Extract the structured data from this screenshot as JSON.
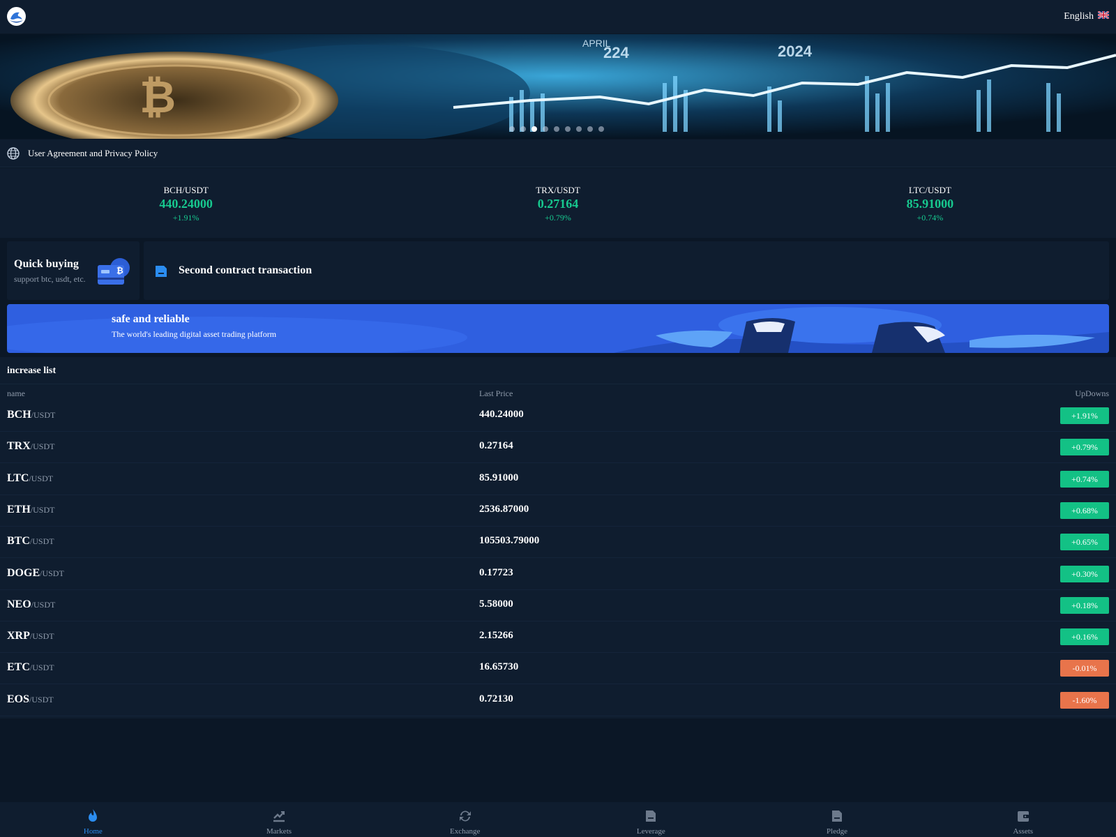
{
  "header": {
    "logo_icon": "dolphin-logo-icon",
    "language_label": "English",
    "flag_icon": "uk-flag-icon"
  },
  "banner": {
    "slide_count": 9,
    "active_slide": 3,
    "overlay_text": [
      "APRIL",
      "224",
      "2024"
    ]
  },
  "notice": {
    "icon": "globe-icon",
    "text": "User Agreement and Privacy Policy"
  },
  "tickers": [
    {
      "pair": "BCH/USDT",
      "price": "440.24000",
      "change": "+1.91%"
    },
    {
      "pair": "TRX/USDT",
      "price": "0.27164",
      "change": "+0.79%"
    },
    {
      "pair": "LTC/USDT",
      "price": "85.91000",
      "change": "+0.74%"
    }
  ],
  "quick_buying": {
    "title": "Quick buying",
    "subtitle": "support btc, usdt, etc.",
    "icon": "bitcoin-card-icon"
  },
  "second_contract": {
    "title": "Second contract transaction",
    "icon": "document-icon"
  },
  "promo": {
    "title": "safe and reliable",
    "subtitle": "The world's leading digital asset trading platform"
  },
  "increase_list": {
    "title": "increase list",
    "columns": {
      "name": "name",
      "price": "Last Price",
      "change": "UpDowns"
    },
    "rows": [
      {
        "base": "BCH",
        "quote": "/USDT",
        "price": "440.24000",
        "change": "+1.91%",
        "direction": "up"
      },
      {
        "base": "TRX",
        "quote": "/USDT",
        "price": "0.27164",
        "change": "+0.79%",
        "direction": "up"
      },
      {
        "base": "LTC",
        "quote": "/USDT",
        "price": "85.91000",
        "change": "+0.74%",
        "direction": "up"
      },
      {
        "base": "ETH",
        "quote": "/USDT",
        "price": "2536.87000",
        "change": "+0.68%",
        "direction": "up"
      },
      {
        "base": "BTC",
        "quote": "/USDT",
        "price": "105503.79000",
        "change": "+0.65%",
        "direction": "up"
      },
      {
        "base": "DOGE",
        "quote": "/USDT",
        "price": "0.17723",
        "change": "+0.30%",
        "direction": "up"
      },
      {
        "base": "NEO",
        "quote": "/USDT",
        "price": "5.58000",
        "change": "+0.18%",
        "direction": "up"
      },
      {
        "base": "XRP",
        "quote": "/USDT",
        "price": "2.15266",
        "change": "+0.16%",
        "direction": "up"
      },
      {
        "base": "ETC",
        "quote": "/USDT",
        "price": "16.65730",
        "change": "-0.01%",
        "direction": "down"
      },
      {
        "base": "EOS",
        "quote": "/USDT",
        "price": "0.72130",
        "change": "-1.60%",
        "direction": "down"
      }
    ]
  },
  "tabbar": {
    "items": [
      {
        "label": "Home",
        "icon": "flame-icon",
        "active": true
      },
      {
        "label": "Markets",
        "icon": "chart-icon",
        "active": false
      },
      {
        "label": "Exchange",
        "icon": "refresh-icon",
        "active": false
      },
      {
        "label": "Leverage",
        "icon": "document-icon",
        "active": false
      },
      {
        "label": "Pledge",
        "icon": "document-icon",
        "active": false
      },
      {
        "label": "Assets",
        "icon": "wallet-icon",
        "active": false
      }
    ]
  },
  "colors": {
    "background": "#0b1726",
    "panel": "#0f1d2f",
    "up": "#13c185",
    "down": "#e8744b",
    "accent": "#2b8df0"
  }
}
